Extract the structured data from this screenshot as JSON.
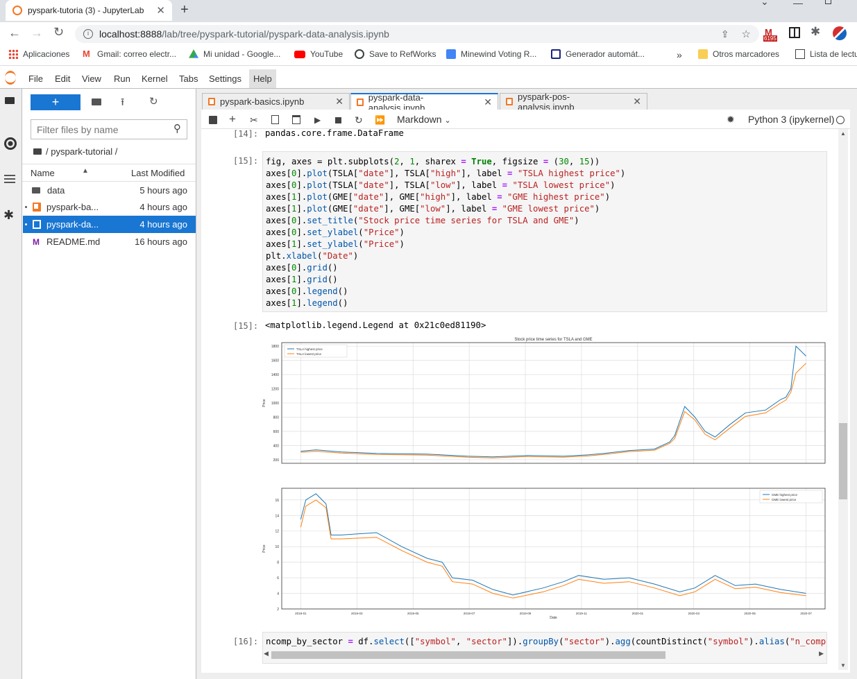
{
  "browser": {
    "tab_title": "pyspark-tutoria (3) - JupyterLab",
    "url_host": "localhost:8888",
    "url_path": "/lab/tree/pyspark-tutorial/pyspark-data-analysis.ipynb",
    "gmail_badge": "6195",
    "bookmarks": [
      "Aplicaciones",
      "Gmail: correo electr...",
      "Mi unidad - Google...",
      "YouTube",
      "Save to RefWorks",
      "Minewind Voting R...",
      "Generador automát..."
    ],
    "overflow": "»",
    "other_bookmarks": "Otros marcadores",
    "reading_list": "Lista de lectu"
  },
  "menu": [
    "File",
    "Edit",
    "View",
    "Run",
    "Kernel",
    "Tabs",
    "Settings",
    "Help"
  ],
  "file_browser": {
    "filter_placeholder": "Filter files by name",
    "breadcrumb": "/ pyspark-tutorial /",
    "col_name": "Name",
    "col_modified": "Last Modified",
    "files": [
      {
        "name": "data",
        "modified": "5 hours ago",
        "type": "folder"
      },
      {
        "name": "pyspark-ba...",
        "modified": "4 hours ago",
        "type": "notebook"
      },
      {
        "name": "pyspark-da...",
        "modified": "4 hours ago",
        "type": "notebook"
      },
      {
        "name": "README.md",
        "modified": "16 hours ago",
        "type": "markdown"
      }
    ]
  },
  "doc_tabs": [
    "pyspark-basics.ipynb",
    "pyspark-data-analysis.ipynb",
    "pyspark-pos-analysis.ipynb"
  ],
  "toolbar": {
    "cell_type": "Markdown",
    "kernel": "Python 3 (ipykernel)"
  },
  "cells": {
    "out14_prompt": "[14]:",
    "out14_text": "pandas.core.frame.DataFrame",
    "in15_prompt": "[15]:",
    "out15_prompt": "[15]:",
    "out15_text": "<matplotlib.legend.Legend at 0x21c0ed81190>",
    "in16_prompt": "[16]:"
  },
  "chart_data": [
    {
      "type": "line",
      "title": "Stock price time series for TSLA and GME",
      "xlabel": "",
      "ylabel": "Price",
      "ylim": [
        150,
        1850
      ],
      "yticks": [
        200,
        400,
        600,
        800,
        1000,
        1200,
        1400,
        1600,
        1800
      ],
      "grid": true,
      "legend": "top-left",
      "x": [
        0,
        0.03,
        0.08,
        0.15,
        0.25,
        0.33,
        0.38,
        0.45,
        0.52,
        0.57,
        0.6,
        0.65,
        0.7,
        0.73,
        0.74,
        0.76,
        0.78,
        0.8,
        0.82,
        0.85,
        0.88,
        0.92,
        0.95,
        0.96,
        0.97,
        0.98,
        1.0
      ],
      "series": [
        {
          "name": "TSLA highest price",
          "color": "#1f77b4",
          "values": [
            320,
            340,
            310,
            290,
            280,
            250,
            240,
            260,
            250,
            270,
            290,
            330,
            350,
            450,
            540,
            950,
            800,
            600,
            520,
            700,
            860,
            900,
            1050,
            1080,
            1200,
            1800,
            1660
          ]
        },
        {
          "name": "TSLA lowest price",
          "color": "#ff7f0e",
          "values": [
            305,
            320,
            295,
            275,
            265,
            235,
            225,
            245,
            235,
            255,
            275,
            315,
            335,
            430,
            500,
            880,
            760,
            560,
            480,
            650,
            810,
            860,
            1000,
            1040,
            1150,
            1420,
            1560
          ]
        }
      ]
    },
    {
      "type": "line",
      "title": "",
      "xlabel": "Date",
      "ylabel": "Price",
      "ylim": [
        2,
        17.5
      ],
      "yticks": [
        2,
        4,
        6,
        8,
        10,
        12,
        14,
        16
      ],
      "xticks": [
        "2019-01",
        "2019-03",
        "2019-05",
        "2019-07",
        "2019-09",
        "2019-11",
        "2020-01",
        "2020-03",
        "2020-05",
        "2020-07"
      ],
      "grid": true,
      "legend": "top-right",
      "x": [
        0,
        0.01,
        0.03,
        0.05,
        0.06,
        0.08,
        0.15,
        0.2,
        0.25,
        0.28,
        0.3,
        0.34,
        0.38,
        0.42,
        0.48,
        0.52,
        0.55,
        0.6,
        0.65,
        0.7,
        0.75,
        0.78,
        0.82,
        0.86,
        0.9,
        0.95,
        1.0
      ],
      "series": [
        {
          "name": "GME highest price",
          "color": "#1f77b4",
          "values": [
            13.5,
            16,
            16.8,
            15.5,
            11.5,
            11.5,
            11.8,
            10,
            8.5,
            8,
            6,
            5.7,
            4.5,
            3.8,
            4.7,
            5.5,
            6.3,
            5.8,
            6,
            5.2,
            4.2,
            4.7,
            6.3,
            5,
            5.2,
            4.5,
            4
          ]
        },
        {
          "name": "GME lowest price",
          "color": "#ff7f0e",
          "values": [
            12.5,
            15.2,
            16,
            15,
            11,
            11,
            11.2,
            9.5,
            8,
            7.5,
            5.5,
            5.2,
            4,
            3.4,
            4.2,
            5,
            5.8,
            5.3,
            5.5,
            4.7,
            3.7,
            4.2,
            5.8,
            4.6,
            4.8,
            4.1,
            3.7
          ]
        }
      ]
    }
  ]
}
